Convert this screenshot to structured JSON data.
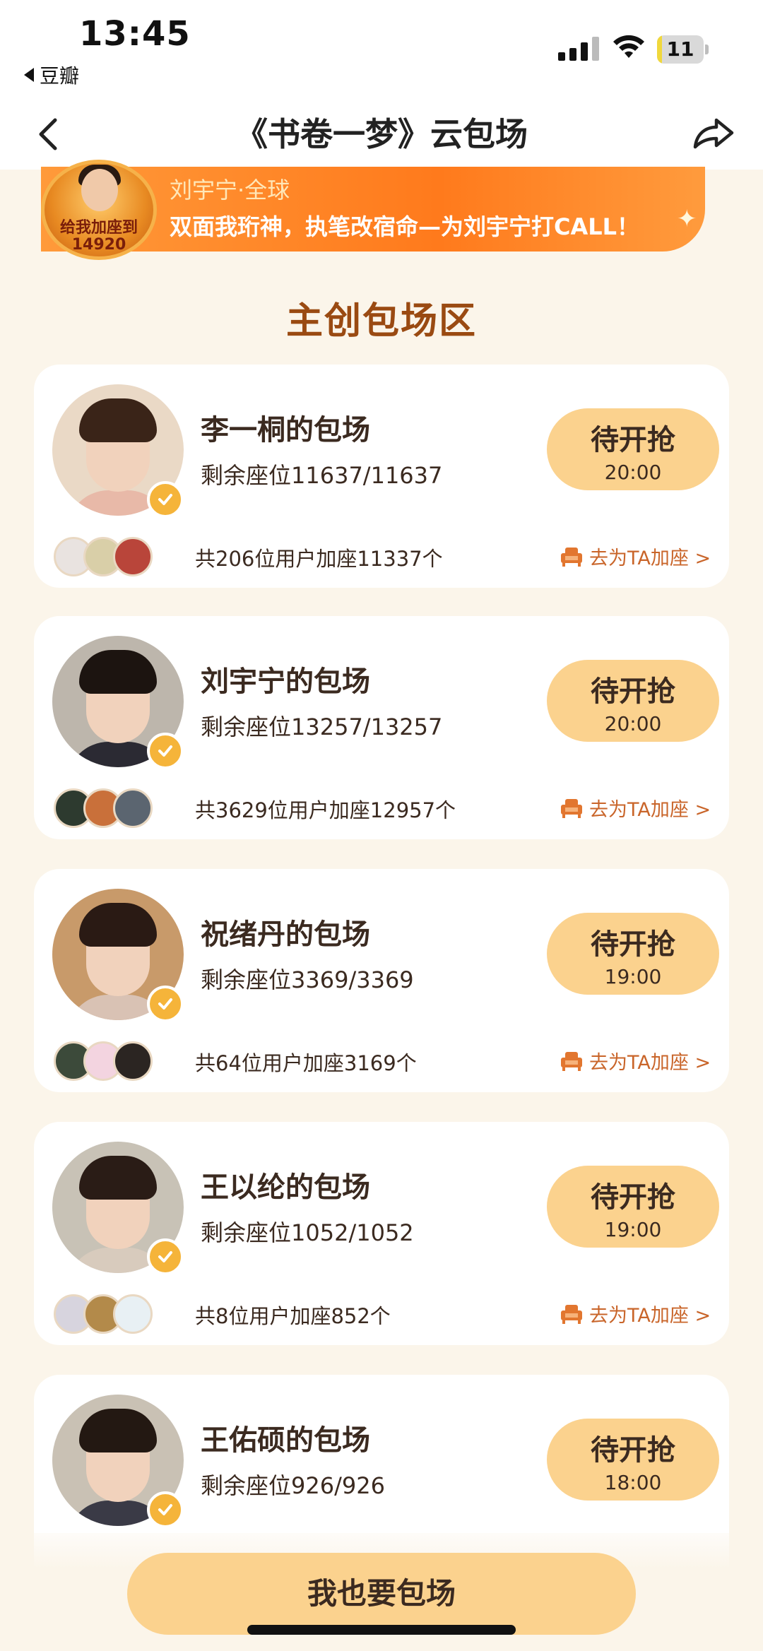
{
  "status_bar": {
    "time": "13:45",
    "back_app": "豆瓣",
    "battery": "11",
    "battery_level": 0.11
  },
  "nav": {
    "title": "《书卷一梦》云包场"
  },
  "banner": {
    "badge_text": "给我加座到 14920",
    "name": "刘宇宁·全球",
    "slogan": "双面我珩神，执笔改宿命—为刘宇宁打CALL！"
  },
  "section_title": "主创包场区",
  "cards": [
    {
      "title": "李一桐的包场",
      "seats": "剩余座位11637/11637",
      "button_label": "待开抢",
      "button_time": "20:00",
      "join_info": "共206位用户加座11337个",
      "join_link": "去为TA加座 >",
      "hair": "#3a2418",
      "robe": "#e8b9a8",
      "bg": "#ead9c6",
      "minis": [
        "#e9e3e0",
        "#d9cfa8",
        "#b9453a"
      ]
    },
    {
      "title": "刘宇宁的包场",
      "seats": "剩余座位13257/13257",
      "button_label": "待开抢",
      "button_time": "20:00",
      "join_info": "共3629位用户加座12957个",
      "join_link": "去为TA加座 >",
      "hair": "#1c1410",
      "robe": "#2b2a33",
      "bg": "#bdb6ac",
      "minis": [
        "#2d3a2f",
        "#c9703a",
        "#5b6570"
      ]
    },
    {
      "title": "祝绪丹的包场",
      "seats": "剩余座位3369/3369",
      "button_label": "待开抢",
      "button_time": "19:00",
      "join_info": "共64位用户加座3169个",
      "join_link": "去为TA加座 >",
      "hair": "#2a1a14",
      "robe": "#d9c2b4",
      "bg": "#c89a6a",
      "minis": [
        "#3c4a3a",
        "#f3d4e0",
        "#2b2522"
      ]
    },
    {
      "title": "王以纶的包场",
      "seats": "剩余座位1052/1052",
      "button_label": "待开抢",
      "button_time": "19:00",
      "join_info": "共8位用户加座852个",
      "join_link": "去为TA加座 >",
      "hair": "#2a1c16",
      "robe": "#d8cbbd",
      "bg": "#c8c2b6",
      "minis": [
        "#d7d4de",
        "#b38a4a",
        "#e8f0f4"
      ]
    },
    {
      "title": "王佑硕的包场",
      "seats": "剩余座位926/926",
      "button_label": "待开抢",
      "button_time": "18:00",
      "join_info": "",
      "join_link": "",
      "hair": "#231812",
      "robe": "#3a3a46",
      "bg": "#c9c1b4",
      "minis": []
    }
  ],
  "bottom_button": "我也要包场"
}
